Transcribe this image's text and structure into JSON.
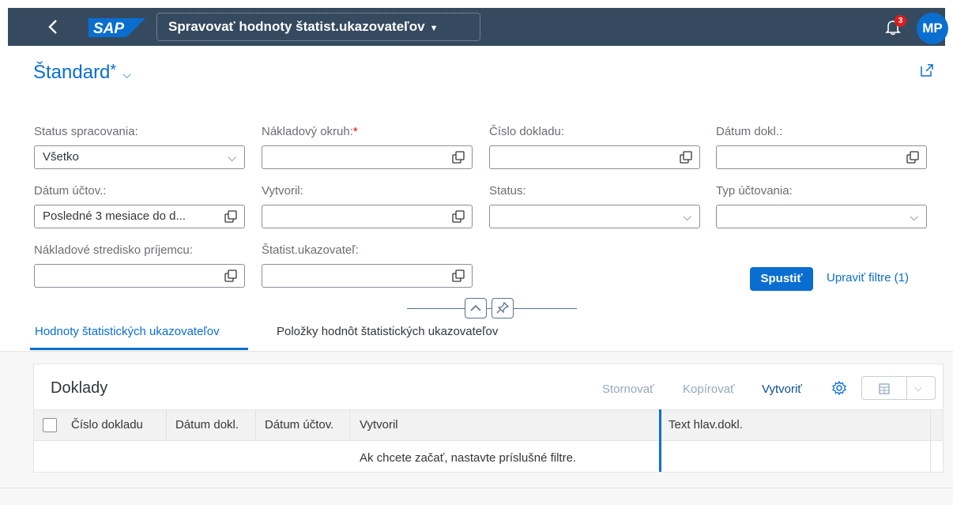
{
  "shell": {
    "back_icon": "chevron-left-icon",
    "logo_text": "SAP",
    "app_title": "Spravovať hodnoty štatist.ukazovateľov",
    "notification_count": "3",
    "avatar_initials": "MP",
    "colors": {
      "bar": "#354a5f",
      "logo": "#0a6ed1",
      "avatar": "#0a6ed1",
      "badge": "#e31a1a"
    }
  },
  "variant": {
    "name": "Štandard",
    "modified_marker": "*"
  },
  "filters": {
    "status_spracovania": {
      "label": "Status spracovania:",
      "value": "Všetko"
    },
    "nakladovy_okruh": {
      "label": "Nákladový okruh:",
      "required_marker": "*",
      "value": ""
    },
    "cislo_dokladu": {
      "label": "Číslo dokladu:",
      "value": ""
    },
    "datum_dokl": {
      "label": "Dátum dokl.:",
      "value": ""
    },
    "datum_uctov": {
      "label": "Dátum účtov.:",
      "value": "Posledné 3 mesiace do d..."
    },
    "vytvoril": {
      "label": "Vytvoril:",
      "value": ""
    },
    "status": {
      "label": "Status:",
      "value": ""
    },
    "typ_uctovania": {
      "label": "Typ účtovania:",
      "value": ""
    },
    "nakladove_stredisko": {
      "label": "Nákladové stredisko príjemcu:",
      "value": ""
    },
    "statist_ukazovatel": {
      "label": "Štatist.ukazovateľ:",
      "value": ""
    },
    "go_label": "Spustiť",
    "adapt_label": "Upraviť filtre (1)"
  },
  "tabs": [
    {
      "label": "Hodnoty štatistických ukazovateľov",
      "selected": true
    },
    {
      "label": "Položky hodnôt štatistických ukazovateľov",
      "selected": false
    }
  ],
  "table": {
    "title": "Doklady",
    "toolbar": {
      "cancel": "Stornovať",
      "copy": "Kopírovať",
      "create": "Vytvoriť"
    },
    "columns": [
      "Číslo dokladu",
      "Dátum dokl.",
      "Dátum účtov.",
      "Vytvoril",
      "Text hlav.dokl."
    ],
    "no_data_text": "Ak chcete začať, nastavte príslušné filtre."
  }
}
